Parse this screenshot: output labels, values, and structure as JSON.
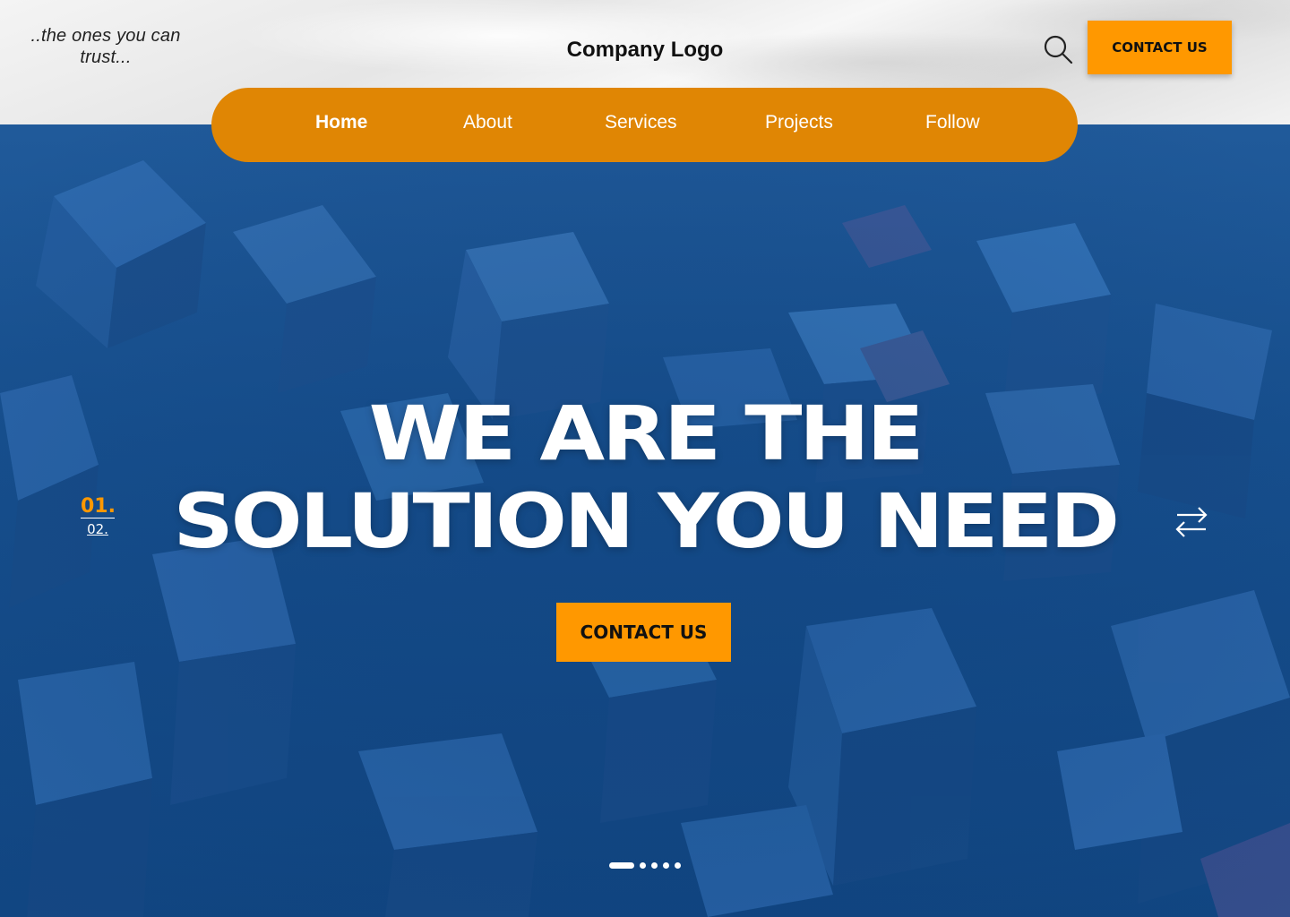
{
  "header": {
    "tagline": "..the ones you can trust...",
    "logo": "Company Logo",
    "search_icon": "search-icon",
    "contact_label": "CONTACT US"
  },
  "nav": {
    "items": [
      {
        "label": "Home",
        "active": true
      },
      {
        "label": "About",
        "active": false
      },
      {
        "label": "Services",
        "active": false
      },
      {
        "label": "Projects",
        "active": false
      },
      {
        "label": "Follow",
        "active": false
      }
    ]
  },
  "hero": {
    "headline_line1": "WE ARE THE",
    "headline_line2": "SOLUTION YOU NEED",
    "slide_current": "01.",
    "slide_next": "02.",
    "swap_icon": "swap-arrows-icon",
    "cta_label": "CONTACT US",
    "carousel_dots": 5,
    "active_dot": 1
  },
  "colors": {
    "accent": "#ff9800",
    "nav_bg": "#e08604",
    "hero_blue": "#17508f",
    "text_light": "#ffffff"
  }
}
